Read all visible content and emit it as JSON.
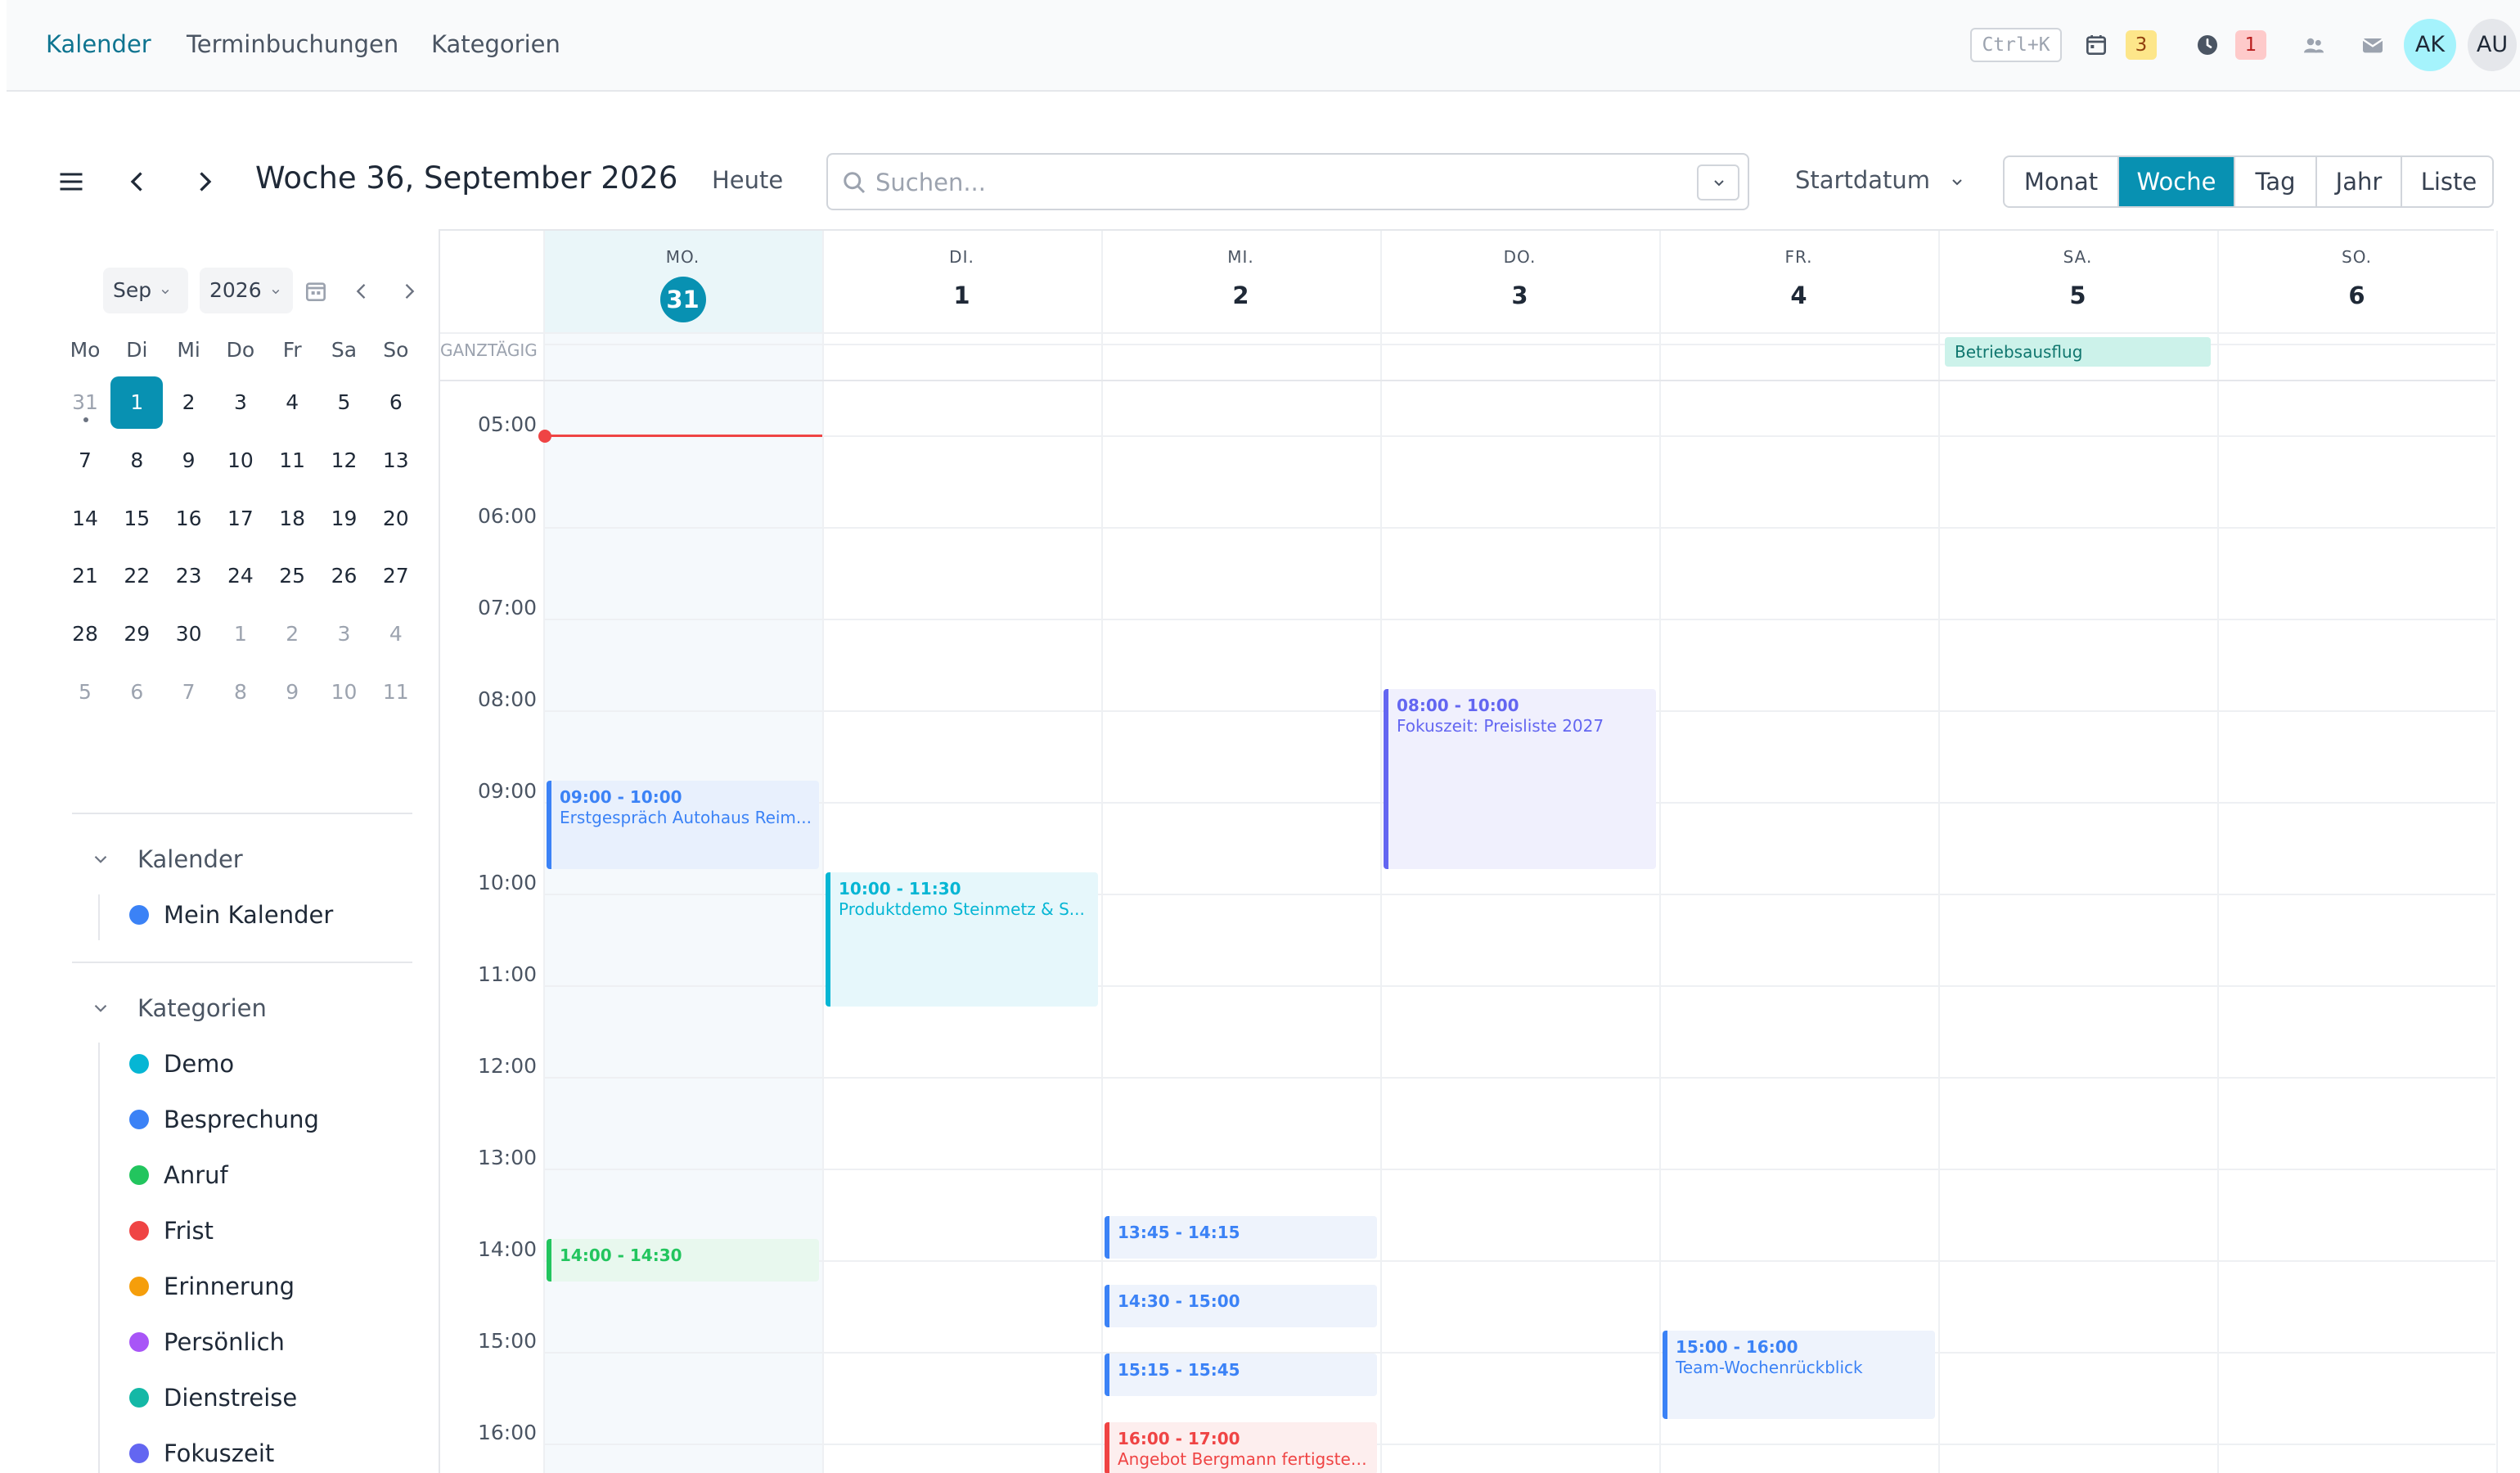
{
  "nav": {
    "tabs": [
      "Kalender",
      "Terminbuchungen",
      "Kategorien"
    ],
    "shortcut": "Ctrl+K",
    "calendar_badge": "3",
    "clock_badge": "1",
    "avatars": [
      "AK",
      "AU"
    ]
  },
  "toolbar": {
    "title": "Woche 36, September 2026",
    "today": "Heute",
    "search_placeholder": "Suchen...",
    "sort_label": "Startdatum",
    "views": [
      "Monat",
      "Woche",
      "Tag",
      "Jahr",
      "Liste"
    ],
    "active_view": "Woche"
  },
  "mini_calendar": {
    "month": "Sep",
    "year": "2026",
    "weekdays": [
      "Mo",
      "Di",
      "Mi",
      "Do",
      "Fr",
      "Sa",
      "So"
    ],
    "weeks": [
      [
        "31",
        "1",
        "2",
        "3",
        "4",
        "5",
        "6"
      ],
      [
        "7",
        "8",
        "9",
        "10",
        "11",
        "12",
        "13"
      ],
      [
        "14",
        "15",
        "16",
        "17",
        "18",
        "19",
        "20"
      ],
      [
        "21",
        "22",
        "23",
        "24",
        "25",
        "26",
        "27"
      ],
      [
        "28",
        "29",
        "30",
        "1",
        "2",
        "3",
        "4"
      ],
      [
        "5",
        "6",
        "7",
        "8",
        "9",
        "10",
        "11"
      ]
    ],
    "selected": "1"
  },
  "sidebar": {
    "calendars_title": "Kalender",
    "calendars": [
      {
        "label": "Mein Kalender",
        "color": "#3b82f6"
      }
    ],
    "categories_title": "Kategorien",
    "categories": [
      {
        "label": "Demo",
        "color": "#06b6d4"
      },
      {
        "label": "Besprechung",
        "color": "#3b82f6"
      },
      {
        "label": "Anruf",
        "color": "#22c55e"
      },
      {
        "label": "Frist",
        "color": "#ef4444"
      },
      {
        "label": "Erinnerung",
        "color": "#f59e0b"
      },
      {
        "label": "Persönlich",
        "color": "#a855f7"
      },
      {
        "label": "Dienstreise",
        "color": "#14b8a6"
      },
      {
        "label": "Fokuszeit",
        "color": "#6366f1"
      }
    ]
  },
  "week": {
    "allday_label": "GANZTÄGIG",
    "days": [
      {
        "abbr": "MO.",
        "num": "31",
        "today": true
      },
      {
        "abbr": "DI.",
        "num": "1",
        "today": false
      },
      {
        "abbr": "MI.",
        "num": "2",
        "today": false
      },
      {
        "abbr": "DO.",
        "num": "3",
        "today": false
      },
      {
        "abbr": "FR.",
        "num": "4",
        "today": false
      },
      {
        "abbr": "SA.",
        "num": "5",
        "today": false
      },
      {
        "abbr": "SO.",
        "num": "6",
        "today": false
      }
    ],
    "hours": [
      "05:00",
      "06:00",
      "07:00",
      "08:00",
      "09:00",
      "10:00",
      "11:00",
      "12:00",
      "13:00",
      "14:00",
      "15:00",
      "16:00"
    ],
    "allday_events": [
      {
        "day": 5,
        "title": "Betriebsausflug",
        "color": "#14b8a6"
      }
    ],
    "events": [
      {
        "day": 0,
        "start": 9.0,
        "end": 10.0,
        "time": "09:00 - 10:00",
        "title": "Erstgespräch Autohaus Reim...",
        "color": "#3b82f6",
        "bg": "#e8f0fd"
      },
      {
        "day": 1,
        "start": 10.0,
        "end": 11.5,
        "time": "10:00 - 11:30",
        "title": "Produktdemo Steinmetz & S...",
        "color": "#06b6d4",
        "bg": "#e6f7fb"
      },
      {
        "day": 3,
        "start": 8.0,
        "end": 10.0,
        "time": "08:00 - 10:00",
        "title": "Fokuszeit: Preisliste 2027",
        "color": "#6366f1",
        "bg": "#f0f0fd"
      },
      {
        "day": 0,
        "start": 14.0,
        "end": 14.5,
        "time": "14:00 - 14:30",
        "title": "",
        "color": "#22c55e",
        "bg": "#e8f8ee"
      },
      {
        "day": 2,
        "start": 13.75,
        "end": 14.25,
        "time": "13:45 - 14:15",
        "title": "",
        "color": "#3b82f6",
        "bg": "#eef3fc"
      },
      {
        "day": 2,
        "start": 14.5,
        "end": 15.0,
        "time": "14:30 - 15:00",
        "title": "",
        "color": "#3b82f6",
        "bg": "#eef3fc"
      },
      {
        "day": 2,
        "start": 15.25,
        "end": 15.75,
        "time": "15:15 - 15:45",
        "title": "",
        "color": "#3b82f6",
        "bg": "#eef3fc"
      },
      {
        "day": 2,
        "start": 16.0,
        "end": 17.0,
        "time": "16:00 - 17:00",
        "title": "Angebot Bergmann fertigstel...",
        "color": "#ef4444",
        "bg": "#fdeeee"
      },
      {
        "day": 4,
        "start": 15.0,
        "end": 16.0,
        "time": "15:00 - 16:00",
        "title": "Team-Wochenrückblick",
        "color": "#3b82f6",
        "bg": "#eef3fc"
      }
    ],
    "now": 5.1,
    "accent": "#0891b2"
  }
}
